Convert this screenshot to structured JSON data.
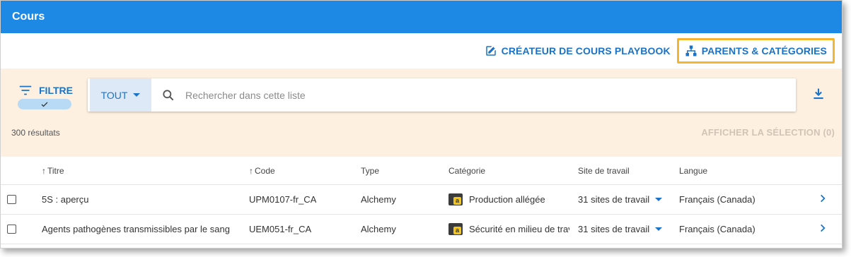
{
  "appbar": {
    "title": "Cours"
  },
  "actions": {
    "playbook_label": "CRÉATEUR DE COURS PLAYBOOK",
    "parents_label": "PARENTS & CATÉGORIES"
  },
  "filter": {
    "label": "FILTRE",
    "scope": "TOUT",
    "search_placeholder": "Rechercher dans cette liste",
    "results": "300 résultats",
    "show_selection": "AFFICHER LA SÉLECTION (0)"
  },
  "table": {
    "headers": {
      "title": "Titre",
      "code": "Code",
      "type": "Type",
      "category": "Catégorie",
      "site": "Site de travail",
      "language": "Langue"
    },
    "rows": [
      {
        "title": "5S : aperçu",
        "code": "UPM0107-fr_CA",
        "type": "Alchemy",
        "category": "Production allégée",
        "site": "31 sites de travail",
        "language": "Français (Canada)"
      },
      {
        "title": "Agents pathogènes transmissibles par le sang",
        "code": "UEM051-fr_CA",
        "type": "Alchemy",
        "category": "Sécurité en milieu de travail",
        "site": "31 sites de travail",
        "language": "Français (Canada)"
      }
    ]
  },
  "colors": {
    "appbar": "#1e88e5",
    "accent": "#1a73c7",
    "filter_bg": "#fdf0e1",
    "highlight": "#f2b632"
  },
  "icons": [
    "edit-square-icon",
    "hierarchy-icon",
    "filter-lines-icon",
    "check-icon",
    "search-icon",
    "download-icon",
    "category-badge-icon",
    "chevron-right-icon",
    "caret-down-icon"
  ]
}
